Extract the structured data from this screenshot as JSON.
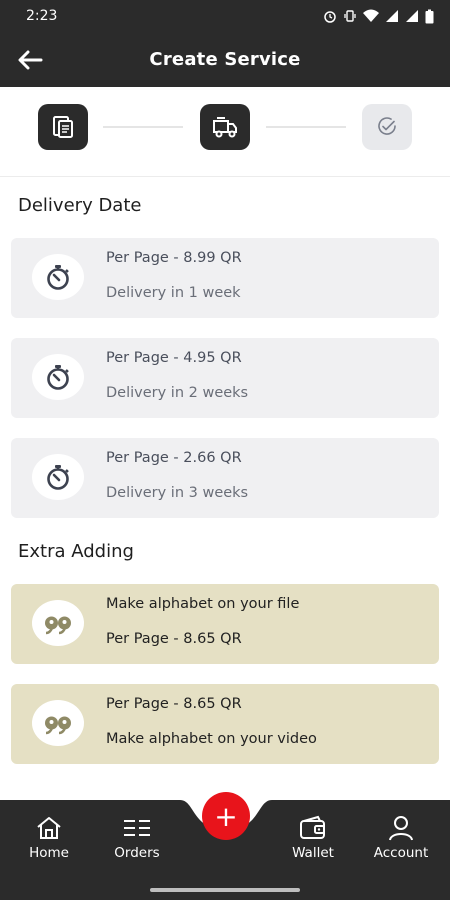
{
  "status": {
    "time": "2:23"
  },
  "appbar": {
    "title": "Create Service"
  },
  "stepper": {
    "steps": [
      "document",
      "delivery",
      "confirm"
    ]
  },
  "delivery": {
    "title": "Delivery Date",
    "options": [
      {
        "price": "Per Page - 8.99 QR",
        "time": "Delivery in 1 week"
      },
      {
        "price": "Per Page - 4.95 QR",
        "time": "Delivery in 2 weeks"
      },
      {
        "price": "Per Page - 2.66 QR",
        "time": "Delivery in 3 weeks"
      }
    ]
  },
  "extra": {
    "title": "Extra Adding",
    "options": [
      {
        "line1": "Make alphabet on your file",
        "line2": "Per Page - 8.65 QR"
      },
      {
        "line1": "Per Page - 8.65 QR",
        "line2": "Make alphabet on your video"
      }
    ]
  },
  "nav": {
    "home": "Home",
    "orders": "Orders",
    "wallet": "Wallet",
    "account": "Account",
    "fab": "+"
  },
  "colors": {
    "dark": "#2b2b2b",
    "accent": "#e8141b",
    "extra_card": "#e5e0c4",
    "delivery_card": "#f0f0f2"
  }
}
